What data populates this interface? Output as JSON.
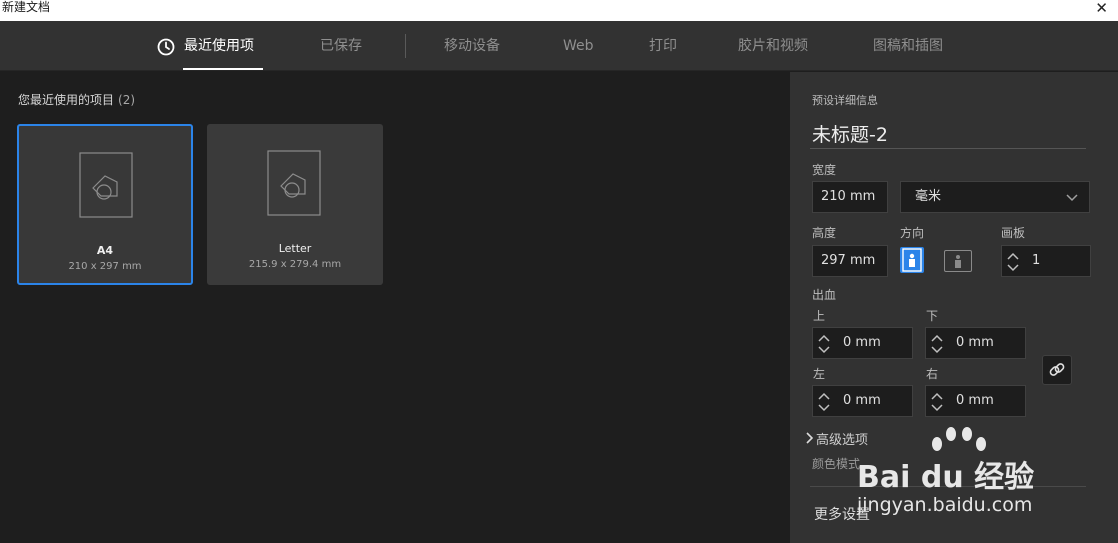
{
  "window": {
    "title": "新建文档",
    "close_glyph": "✕"
  },
  "tabs": [
    {
      "label": "最近使用项",
      "active": true,
      "icon": "clock-icon"
    },
    {
      "label": "已保存"
    },
    {
      "label": "移动设备"
    },
    {
      "label": "Web"
    },
    {
      "label": "打印"
    },
    {
      "label": "胶片和视频"
    },
    {
      "label": "图稿和插图"
    }
  ],
  "recent": {
    "title": "您最近使用的项目",
    "count": "(2)",
    "items": [
      {
        "name": "A4",
        "size": "210 x 297 mm",
        "selected": true
      },
      {
        "name": "Letter",
        "size": "215.9 x 279.4 mm",
        "selected": false
      }
    ]
  },
  "preset": {
    "section_label": "预设详细信息",
    "doc_title": "未标题-2",
    "width_label": "宽度",
    "width_value": "210 mm",
    "unit_value": "毫米",
    "height_label": "高度",
    "height_value": "297 mm",
    "orientation_label": "方向",
    "orientation": "portrait",
    "artboards_label": "画板",
    "artboards_value": "1",
    "bleed_label": "出血",
    "bleed": {
      "top_label": "上",
      "top_value": "0 mm",
      "bottom_label": "下",
      "bottom_value": "0 mm",
      "left_label": "左",
      "left_value": "0 mm",
      "right_label": "右",
      "right_value": "0 mm"
    },
    "advanced_label": "高级选项",
    "color_mode_text": "颜色模式",
    "more_settings_label": "更多设置"
  },
  "watermark": {
    "brand": "Bai du 经验",
    "url": "jingyan.baidu.com"
  },
  "colors": {
    "accent": "#2b84e9",
    "panel": "#323232",
    "background": "#1e1e1e"
  }
}
